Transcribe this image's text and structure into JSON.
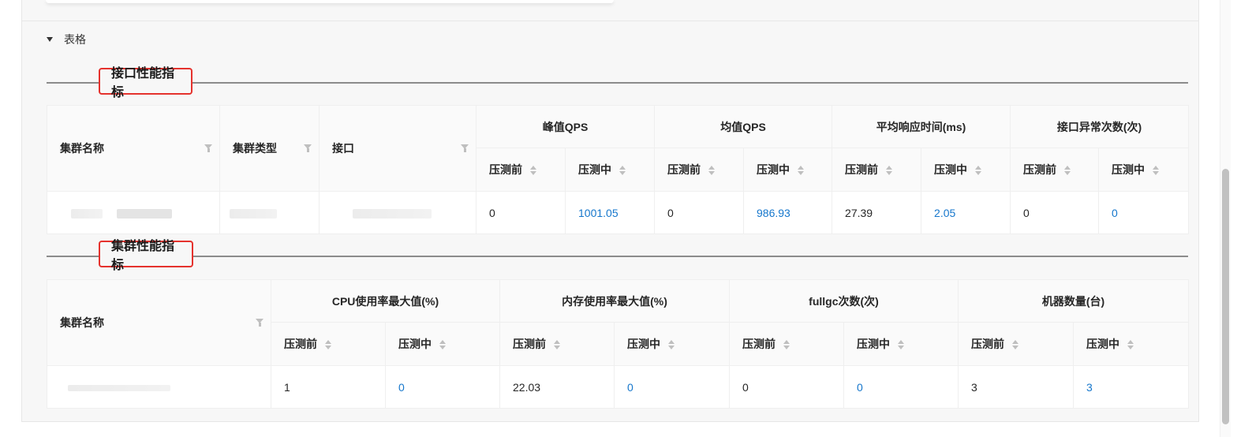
{
  "collapse": {
    "label": "表格"
  },
  "sections": {
    "interface": "接口性能指标",
    "cluster": "集群性能指标"
  },
  "sub": {
    "before": "压测前",
    "during": "压测中"
  },
  "interface_table": {
    "col_cluster_name": "集群名称",
    "col_cluster_type": "集群类型",
    "col_interface": "接口",
    "groups": [
      "峰值QPS",
      "均值QPS",
      "平均响应时间(ms)",
      "接口异常次数(次)"
    ],
    "row": {
      "peak_before": "0",
      "peak_during": "1001.05",
      "avg_before": "0",
      "avg_during": "986.93",
      "rt_before": "27.39",
      "rt_during": "2.05",
      "err_before": "0",
      "err_during": "0"
    }
  },
  "cluster_table": {
    "col_cluster_name": "集群名称",
    "groups": [
      "CPU使用率最大值(%)",
      "内存使用率最大值(%)",
      "fullgc次数(次)",
      "机器数量(台)"
    ],
    "row": {
      "cpu_before": "1",
      "cpu_during": "0",
      "mem_before": "22.03",
      "mem_during": "0",
      "gc_before": "0",
      "gc_during": "0",
      "machines_before": "3",
      "machines_during": "3"
    }
  },
  "colors": {
    "link": "#1677cc",
    "highlight_border": "#e5322d",
    "section_line": "#8c8c8c"
  },
  "icons": [
    "caret-down-icon",
    "filter-icon",
    "sort-icon"
  ]
}
